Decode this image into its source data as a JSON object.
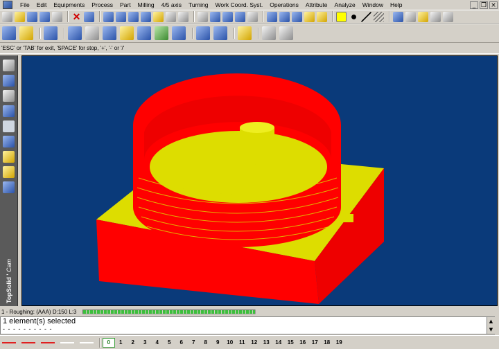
{
  "menubar": {
    "items": [
      "File",
      "Edit",
      "Equipments",
      "Process",
      "Part",
      "Milling",
      "4/5 axis",
      "Turning",
      "Work Coord. Syst.",
      "Operations",
      "Attribute",
      "Analyze",
      "Window",
      "Help"
    ]
  },
  "window_controls": {
    "minimize": "_",
    "restore": "❐",
    "close": "×"
  },
  "toolbar1": {
    "icons": [
      "new-file-icon",
      "open-file-icon",
      "save-icon",
      "info-icon",
      "print-icon",
      "delete-icon",
      "undo-icon",
      "redo-icon",
      "edit-icon",
      "filter-icon",
      "snap-icon",
      "point-icon",
      "circle-icon",
      "cursor-icon",
      "measure-icon",
      "pick-icon",
      "select-icon",
      "select-all-icon",
      "arrow-icon",
      "zoom-icon",
      "zoom-window-icon",
      "view-icon",
      "render-icon",
      "axis-icon",
      "color-swatch-icon",
      "point-style-icon",
      "line-style-icon",
      "hatch-icon",
      "part-icon",
      "document-icon",
      "drawing-icon",
      "export-icon",
      "settings-icon"
    ],
    "active_color": "#ffff00"
  },
  "toolbar2": {
    "icons": [
      "machine-icon",
      "tool-icon",
      "stock-icon",
      "pocket-icon",
      "contour-icon",
      "drill-icon",
      "face-icon",
      "surface-icon",
      "roughing-icon",
      "finishing-icon",
      "simulate-icon",
      "verify-icon",
      "tool-library-icon",
      "report-icon",
      "nc-code-icon"
    ]
  },
  "prompt": {
    "text": "'ESC' or 'TAB' for exit, 'SPACE' for stop, '+', '-' or '/'"
  },
  "left_panel": {
    "icons": [
      "pencil-icon",
      "cube-icon",
      "curve-icon",
      "surface-icon",
      "machine-icon",
      "tools-icon",
      "operations-icon",
      "cam-icon",
      "simulation-icon"
    ],
    "brand_main": "TopSolid",
    "brand_sep": "'",
    "brand_cam": "Cam"
  },
  "status": {
    "text": "1 - Roughing:    (AAA)  D:150  L:3",
    "progress": 1.0
  },
  "message": {
    "line1": "1 element(s) selected",
    "line2": "- - - - - - - - - -"
  },
  "scroll": {
    "up": "▲",
    "down": "▼"
  },
  "layerbar": {
    "active": "0",
    "layers": [
      "0",
      "1",
      "2",
      "3",
      "4",
      "5",
      "6",
      "7",
      "8",
      "9",
      "10",
      "11",
      "12",
      "13",
      "14",
      "15",
      "16",
      "17",
      "18",
      "19"
    ]
  },
  "colors": {
    "viewport_bg": "#0a3a7a",
    "part_red": "#ff0000",
    "part_yellow": "#dddd00",
    "progress_green": "#3cc03c"
  }
}
